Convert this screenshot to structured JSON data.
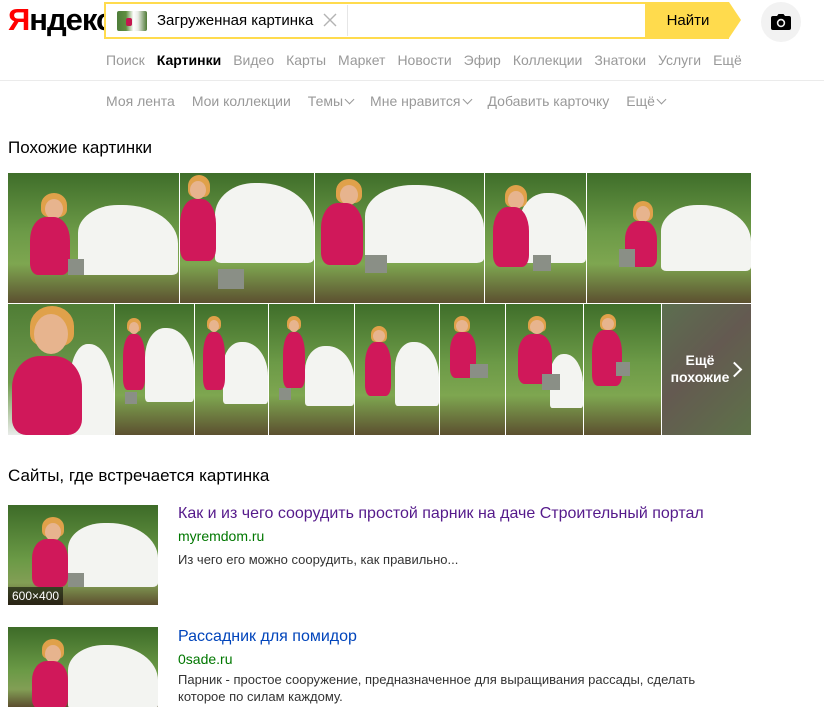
{
  "logo": {
    "first_letter": "Я",
    "rest": "ндекс"
  },
  "search": {
    "chip_label": "Загруженная картинка",
    "button_label": "Найти"
  },
  "nav": {
    "tabs": [
      {
        "label": "Поиск",
        "active": false
      },
      {
        "label": "Картинки",
        "active": true
      },
      {
        "label": "Видео",
        "active": false
      },
      {
        "label": "Карты",
        "active": false
      },
      {
        "label": "Маркет",
        "active": false
      },
      {
        "label": "Новости",
        "active": false
      },
      {
        "label": "Эфир",
        "active": false
      },
      {
        "label": "Коллекции",
        "active": false
      },
      {
        "label": "Знатоки",
        "active": false
      },
      {
        "label": "Услуги",
        "active": false
      },
      {
        "label": "Ещё",
        "active": false
      }
    ]
  },
  "subnav": {
    "items": [
      {
        "label": "Моя лента",
        "dropdown": false
      },
      {
        "label": "Мои коллекции",
        "dropdown": false
      },
      {
        "label": "Темы",
        "dropdown": true
      },
      {
        "label": "Мне нравится",
        "dropdown": true
      },
      {
        "label": "Добавить карточку",
        "dropdown": false
      },
      {
        "label": "Ещё",
        "dropdown": true
      }
    ]
  },
  "similar": {
    "title": "Похожие картинки",
    "more_label_line1": "Ещё",
    "more_label_line2": "похожие"
  },
  "sites": {
    "title": "Сайты, где встречается картинка",
    "results": [
      {
        "title": "Как и из чего соорудить простой парник на даче Строительный портал",
        "host": "myremdom.ru",
        "snippet": "Из чего его можно соорудить, как правильно...",
        "size": "600×400",
        "visited": true
      },
      {
        "title": "Рассадник для помидор",
        "host": "0sade.ru",
        "snippet": "Парник - простое сооружение, предназначенное для выращивания рассады, сделать которое по силам каждому.",
        "size": "",
        "visited": false
      }
    ]
  },
  "colors": {
    "brand_yellow": "#ffdb4d",
    "logo_red": "#ff0000",
    "link_blue": "#0044bb",
    "visited_purple": "#551a8b",
    "host_green": "#007700"
  }
}
